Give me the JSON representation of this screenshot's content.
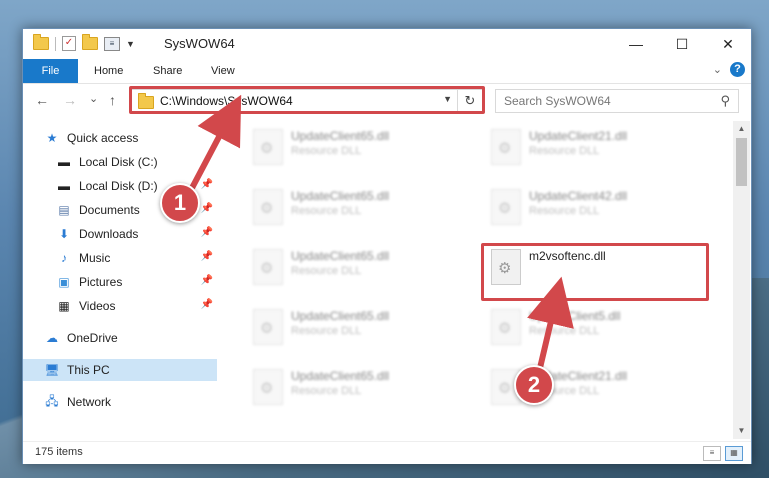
{
  "window": {
    "title": "SysWOW64"
  },
  "caption": {
    "minimize": "—",
    "maximize": "☐",
    "close": "✕"
  },
  "ribbon": {
    "tabs": [
      "File",
      "Home",
      "Share",
      "View"
    ],
    "help": "?"
  },
  "address": {
    "path": "C:\\Windows\\SysWOW64",
    "refresh": "↻"
  },
  "search": {
    "placeholder": "Search SysWOW64"
  },
  "nav": {
    "back": "←",
    "forward": "→",
    "recent": "⌄",
    "up": "↑"
  },
  "sidebar": {
    "items": [
      {
        "label": "Quick access",
        "icon": "star-icon"
      },
      {
        "label": "Local Disk (C:)",
        "icon": "drive-icon"
      },
      {
        "label": "Local Disk (D:)",
        "icon": "drive-icon"
      },
      {
        "label": "Documents",
        "icon": "documents-icon"
      },
      {
        "label": "Downloads",
        "icon": "downloads-icon"
      },
      {
        "label": "Music",
        "icon": "music-icon"
      },
      {
        "label": "Pictures",
        "icon": "pictures-icon"
      },
      {
        "label": "Videos",
        "icon": "videos-icon"
      },
      {
        "label": "OneDrive",
        "icon": "cloud-icon"
      },
      {
        "label": "This PC",
        "icon": "computer-icon"
      },
      {
        "label": "Network",
        "icon": "network-icon"
      }
    ]
  },
  "files": [
    {
      "name": "UpdateClient65.dll",
      "type": "Resource DLL"
    },
    {
      "name": "UpdateClient21.dll",
      "type": "Resource DLL"
    },
    {
      "name": "UpdateClient65.dll",
      "type": "Resource DLL"
    },
    {
      "name": "UpdateClient42.dll",
      "type": "Resource DLL"
    },
    {
      "name": "UpdateClient65.dll",
      "type": "Resource DLL"
    },
    {
      "name": "m2vsoftenc.dll",
      "type": ""
    },
    {
      "name": "UpdateClient65.dll",
      "type": "Resource DLL"
    },
    {
      "name": "UpdateClient5.dll",
      "type": "Resource DLL"
    },
    {
      "name": "UpdateClient65.dll",
      "type": "Resource DLL"
    },
    {
      "name": "UpdateClient21.dll",
      "type": "Resource DLL"
    }
  ],
  "status": {
    "count": "175 items"
  },
  "callouts": {
    "one": "1",
    "two": "2"
  },
  "colors": {
    "accent": "#1979ca",
    "highlight": "#d2484b",
    "selection": "#cce4f7"
  }
}
